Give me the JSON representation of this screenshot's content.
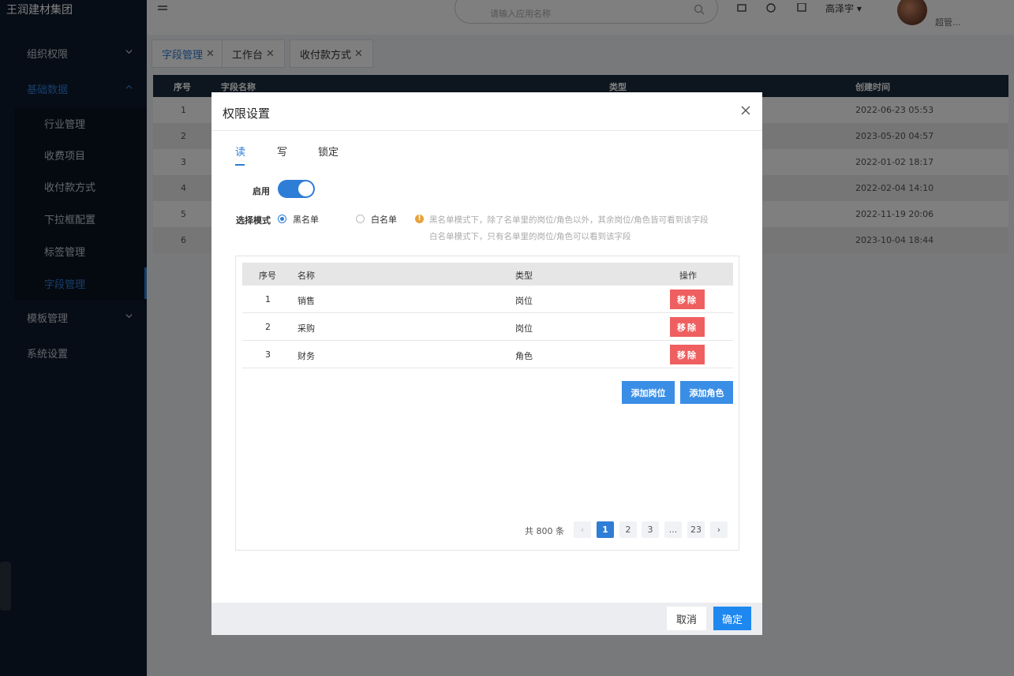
{
  "app": {
    "brand": "王润建材集团",
    "search_placeholder": "请输入应用名称",
    "user_name": "高泽宇 ▾",
    "user_role": "超管..."
  },
  "sidebar": {
    "items": [
      {
        "label": "组织权限"
      },
      {
        "label": "基础数据"
      },
      {
        "label": "模板管理"
      },
      {
        "label": "系统设置"
      }
    ],
    "submenu": [
      {
        "label": "行业管理"
      },
      {
        "label": "收费项目"
      },
      {
        "label": "收付款方式"
      },
      {
        "label": "下拉框配置"
      },
      {
        "label": "标签管理"
      },
      {
        "label": "字段管理"
      }
    ]
  },
  "tabs": [
    {
      "label": "字段管理"
    },
    {
      "label": "工作台"
    },
    {
      "label": "收付款方式"
    }
  ],
  "bg_table": {
    "headers": [
      "序号",
      "字段名称",
      "类型",
      "创建时间"
    ],
    "rows": [
      {
        "idx": "1",
        "time": "2022-06-23 05:53"
      },
      {
        "idx": "2",
        "time": "2023-05-20 04:57"
      },
      {
        "idx": "3",
        "time": "2022-01-02 18:17"
      },
      {
        "idx": "4",
        "time": "2022-02-04 14:10"
      },
      {
        "idx": "5",
        "time": "2022-11-19 20:06"
      },
      {
        "idx": "6",
        "time": "2023-10-04 18:44"
      }
    ]
  },
  "dialog": {
    "title": "权限设置",
    "tabs": [
      "读",
      "写",
      "锁定"
    ],
    "enable_label": "启用",
    "mode_label": "选择模式",
    "blacklist_label": "黑名单",
    "whitelist_label": "白名单",
    "hint_line1": "黑名单模式下，除了名单里的岗位/角色以外，其余岗位/角色皆可看到该字段",
    "hint_line2": "白名单模式下，只有名单里的岗位/角色可以看到该字段",
    "table_headers": [
      "序号",
      "名称",
      "类型",
      "操作"
    ],
    "rows": [
      {
        "idx": "1",
        "name": "销售",
        "type": "岗位",
        "action": "移除"
      },
      {
        "idx": "2",
        "name": "采购",
        "type": "岗位",
        "action": "移除"
      },
      {
        "idx": "3",
        "name": "财务",
        "type": "角色",
        "action": "移除"
      }
    ],
    "add_post_label": "添加岗位",
    "add_role_label": "添加角色",
    "pager": {
      "total": "共 800 条",
      "pages": [
        "1",
        "2",
        "3",
        "...",
        "23"
      ],
      "current": "1"
    },
    "cancel_label": "取消",
    "ok_label": "确定"
  },
  "colors": {
    "accent": "#2e7dd6",
    "sidebar_bg": "#0e1b2e",
    "danger": "#ef5f5f",
    "warning": "#e6a23c"
  }
}
